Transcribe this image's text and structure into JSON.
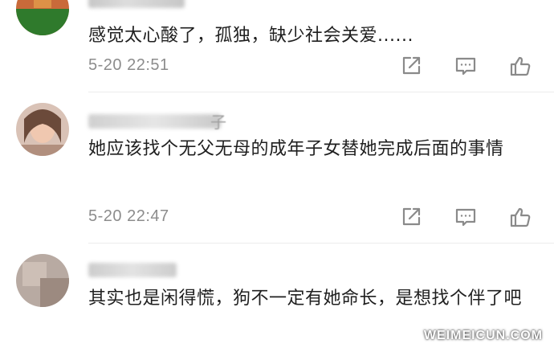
{
  "comments": [
    {
      "text": "感觉太心酸了，孤独，缺少社会关爱......",
      "time": "5-20 22:51"
    },
    {
      "username_partial": "子",
      "text": "她应该找个无父无母的成年子女替她完成后面的事情",
      "time": "5-20 22:47"
    },
    {
      "text": "其实也是闲得慌，狗不一定有她命长，是想找个伴了吧"
    }
  ],
  "icons": {
    "share": "share-icon",
    "reply": "comment-icon",
    "like": "thumbs-up-icon"
  },
  "colors": {
    "text": "#1f1f1f",
    "meta": "#8c8c8c",
    "icon": "#8a8a8a"
  },
  "watermark": "WEIMEICUN.COM"
}
